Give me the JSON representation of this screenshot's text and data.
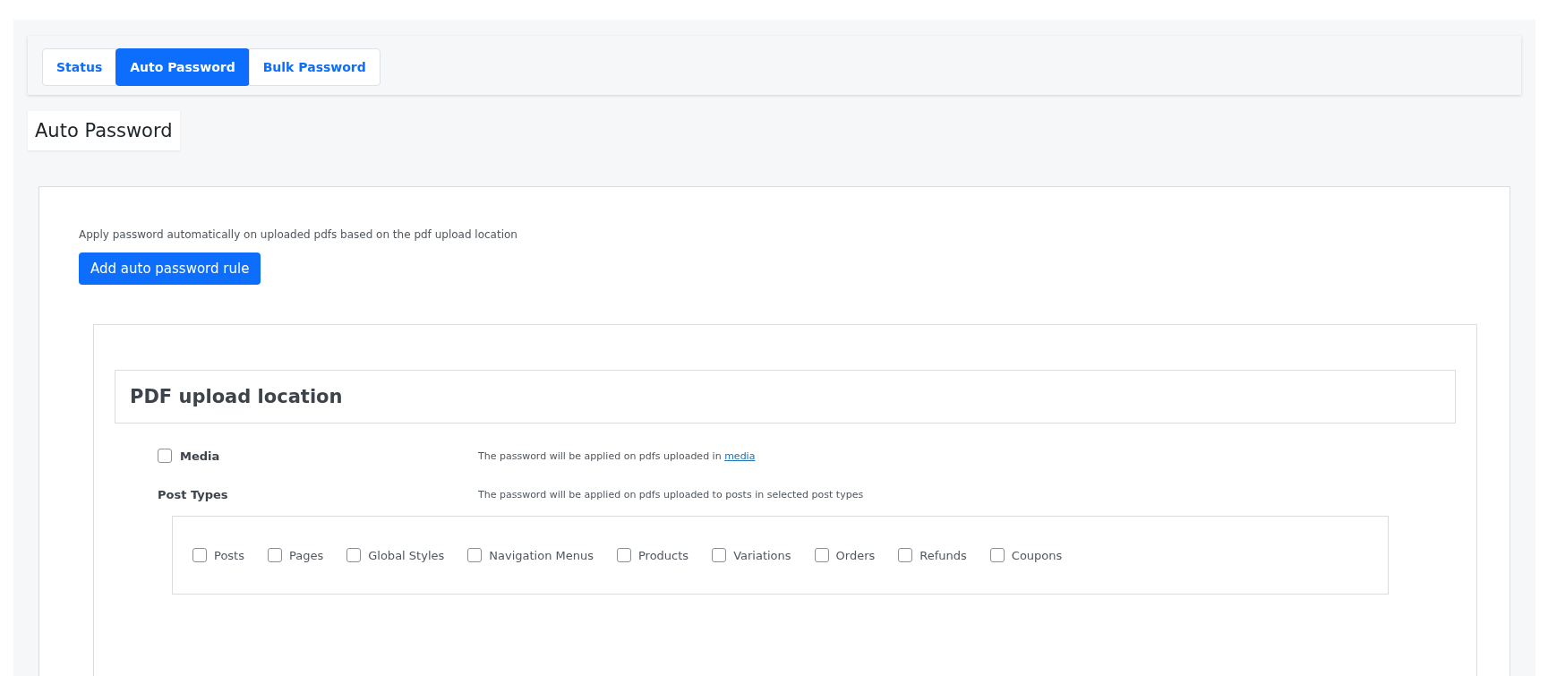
{
  "tabs": [
    {
      "label": "Status",
      "selected": false
    },
    {
      "label": "Auto Password",
      "selected": true
    },
    {
      "label": "Bulk Password",
      "selected": false
    }
  ],
  "page_title": "Auto Password",
  "description": "Apply password automatically on uploaded pdfs based on the pdf upload location",
  "add_button": "Add auto password rule",
  "section_title": "PDF upload location",
  "media": {
    "label": "Media",
    "checked": false,
    "hint": "The password will be applied on pdfs uploaded in",
    "link": "media"
  },
  "post_types": {
    "label": "Post Types",
    "hint": "The password will be applied on pdfs uploaded to posts in selected post types",
    "options": [
      {
        "label": "Posts",
        "checked": false
      },
      {
        "label": "Pages",
        "checked": false
      },
      {
        "label": "Global Styles",
        "checked": false
      },
      {
        "label": "Navigation Menus",
        "checked": false
      },
      {
        "label": "Products",
        "checked": false
      },
      {
        "label": "Variations",
        "checked": false
      },
      {
        "label": "Orders",
        "checked": false
      },
      {
        "label": "Refunds",
        "checked": false
      },
      {
        "label": "Coupons",
        "checked": false
      }
    ]
  }
}
